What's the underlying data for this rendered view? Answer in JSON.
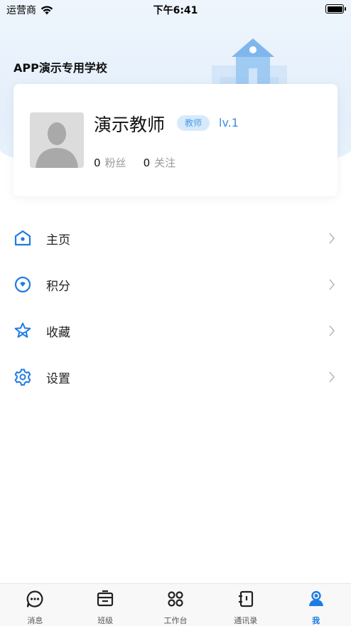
{
  "status_bar": {
    "carrier": "运营商",
    "time": "下午6:41"
  },
  "header": {
    "school_name": "APP演示专用学校"
  },
  "profile": {
    "name": "演示教师",
    "role_badge": "教师",
    "level": "lv.1",
    "followers_count": "0",
    "followers_label": "粉丝",
    "following_count": "0",
    "following_label": "关注"
  },
  "menu": {
    "items": [
      {
        "label": "主页",
        "icon": "home-icon"
      },
      {
        "label": "积分",
        "icon": "points-icon"
      },
      {
        "label": "收藏",
        "icon": "star-icon"
      },
      {
        "label": "设置",
        "icon": "gear-icon"
      }
    ]
  },
  "tab_bar": {
    "active": "我",
    "tabs": [
      {
        "label": "消息",
        "icon": "message-icon"
      },
      {
        "label": "班级",
        "icon": "class-icon"
      },
      {
        "label": "工作台",
        "icon": "workbench-icon"
      },
      {
        "label": "通讯录",
        "icon": "contacts-icon"
      },
      {
        "label": "我",
        "icon": "me-icon"
      }
    ]
  },
  "colors": {
    "accent": "#1e7be3",
    "badge_bg": "#d6eafb",
    "header_bg": "#e4effb"
  }
}
